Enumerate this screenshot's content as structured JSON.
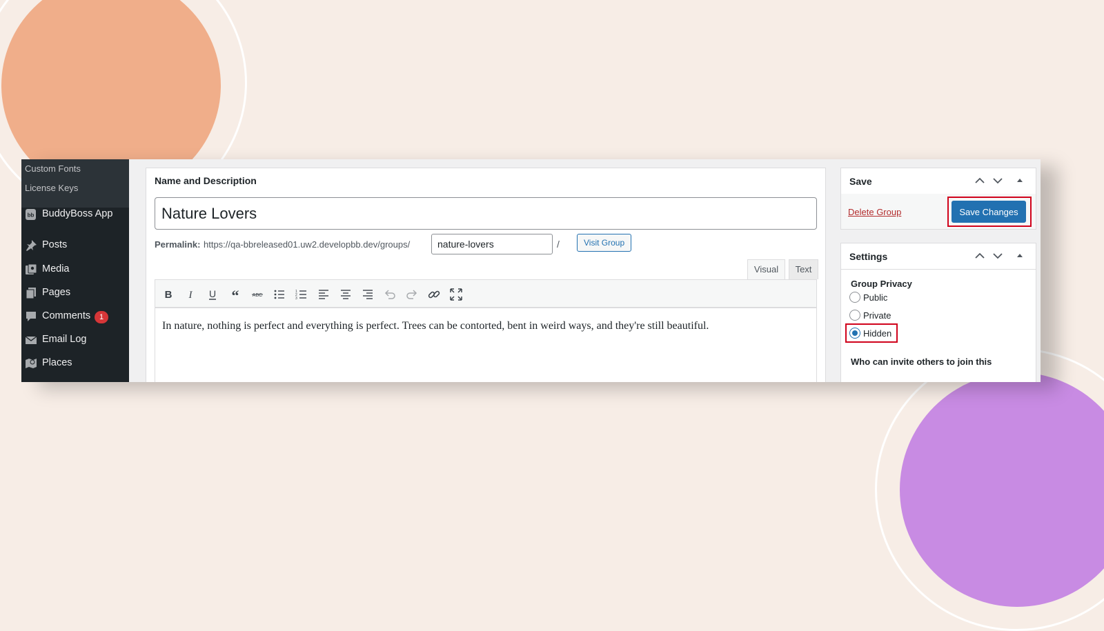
{
  "sidebar": {
    "submenu": [
      "Custom Fonts",
      "License Keys"
    ],
    "items": [
      {
        "label": "BuddyBoss App",
        "icon": "buddyboss-icon"
      },
      {
        "label": "Posts",
        "icon": "pin-icon"
      },
      {
        "label": "Media",
        "icon": "media-icon"
      },
      {
        "label": "Pages",
        "icon": "pages-icon"
      },
      {
        "label": "Comments",
        "icon": "comment-icon",
        "badge": "1"
      },
      {
        "label": "Email Log",
        "icon": "envelope-icon"
      },
      {
        "label": "Places",
        "icon": "map-icon"
      }
    ]
  },
  "editor": {
    "panel_title": "Name and Description",
    "group_name": "Nature Lovers",
    "permalink_label": "Permalink:",
    "permalink_url": "https://qa-bbreleased01.uw2.developbb.dev/groups/",
    "slug": "nature-lovers",
    "slash": "/",
    "visit_group": "Visit Group",
    "tabs": {
      "visual": "Visual",
      "text": "Text"
    },
    "content": "In nature, nothing is perfect and everything is perfect. Trees can be contorted, bent in weird ways, and they're still beautiful."
  },
  "save_box": {
    "title": "Save",
    "delete_label": "Delete Group",
    "save_label": "Save Changes"
  },
  "settings_box": {
    "title": "Settings",
    "privacy_title": "Group Privacy",
    "options": [
      "Public",
      "Private",
      "Hidden"
    ],
    "selected": "Hidden",
    "invite_title": "Who can invite others to join this"
  },
  "colors": {
    "background": "#f7ede6",
    "sidebar": "#1d2327",
    "accent": "#2271b1",
    "highlight": "#d0021b",
    "orange_circle": "#f0ae8a",
    "purple_circle": "#c88be3"
  }
}
